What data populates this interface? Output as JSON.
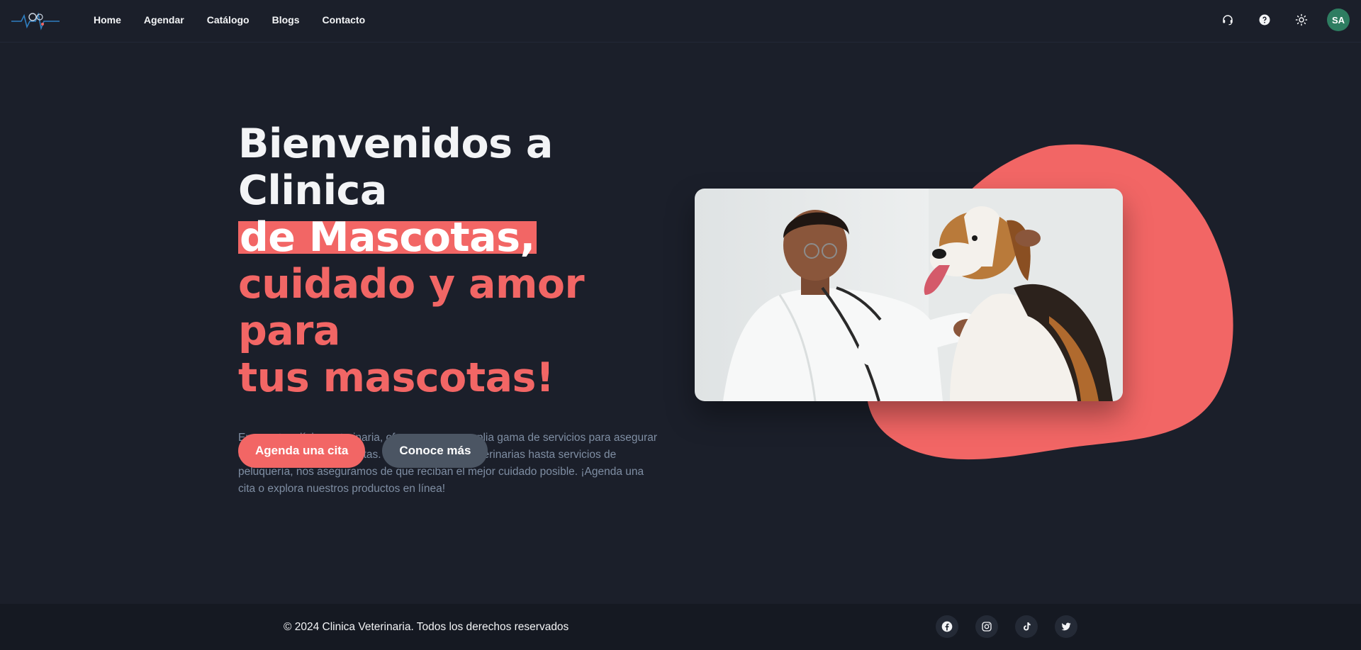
{
  "nav": {
    "items": [
      {
        "label": "Home"
      },
      {
        "label": "Agendar"
      },
      {
        "label": "Catálogo"
      },
      {
        "label": "Blogs"
      },
      {
        "label": "Contacto"
      }
    ]
  },
  "header": {
    "icons": [
      "support-icon",
      "help-icon",
      "theme-sun-icon"
    ],
    "avatar_initials": "SA"
  },
  "hero": {
    "title_line1": "Bienvenidos a Clinica",
    "title_highlight": "de Mascotas,",
    "title_line3": "cuidado y amor para",
    "title_line4": "tus mascotas!",
    "description": "En nuestra clínica veterinaria, ofrecemos una amplia gama de servicios para asegurar el bienestar de tus mascotas. Desde consultas veterinarias hasta servicios de peluquería, nos aseguramos de que reciban el mejor cuidado posible. ¡Agenda una cita o explora nuestros productos en línea!",
    "primary_button": "Agenda una cita",
    "secondary_button": "Conoce más"
  },
  "footer": {
    "copyright": "© 2024 Clinica Veterinaria. Todos los derechos reservados",
    "social_icons": [
      "facebook-icon",
      "instagram-icon",
      "tiktok-icon",
      "twitter-icon"
    ]
  },
  "colors": {
    "background": "#1b1f2a",
    "accent": "#f26665",
    "secondary_button": "#4b5563",
    "avatar": "#2e7d61",
    "footer": "#151922"
  }
}
